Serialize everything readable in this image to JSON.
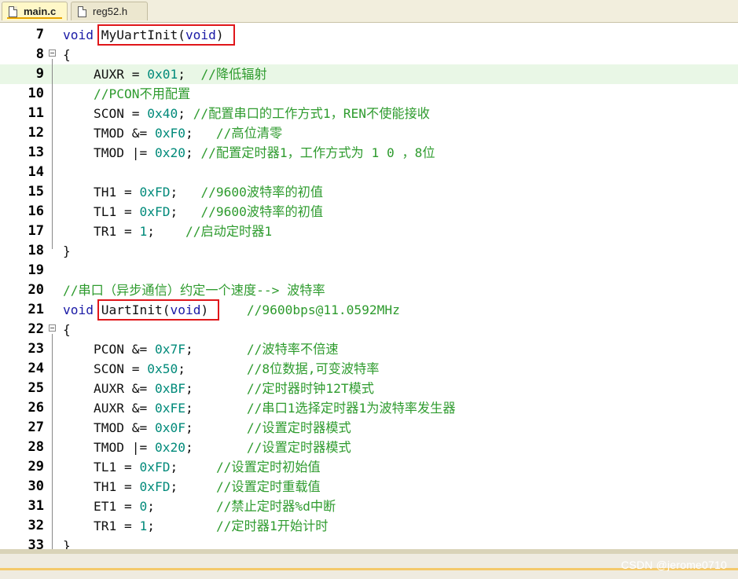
{
  "tabs": [
    {
      "label": "main.c",
      "active": true
    },
    {
      "label": "reg52.h",
      "active": false
    }
  ],
  "lines": [
    {
      "n": "7",
      "fold": false,
      "hl": false,
      "segs": [
        [
          "kw",
          "void"
        ],
        [
          "t",
          " "
        ],
        [
          "t",
          "MyUartInit("
        ],
        [
          "kw",
          "void"
        ],
        [
          "t",
          ")"
        ]
      ]
    },
    {
      "n": "8",
      "fold": true,
      "hl": false,
      "segs": [
        [
          "t",
          "{"
        ]
      ]
    },
    {
      "n": "9",
      "fold": false,
      "hl": true,
      "segs": [
        [
          "t",
          "    AUXR = "
        ],
        [
          "num",
          "0x01"
        ],
        [
          "t",
          ";  "
        ],
        [
          "cm",
          "//降低辐射"
        ]
      ]
    },
    {
      "n": "10",
      "fold": false,
      "hl": false,
      "segs": [
        [
          "cm",
          "    //PCON不用配置"
        ]
      ]
    },
    {
      "n": "11",
      "fold": false,
      "hl": false,
      "segs": [
        [
          "t",
          "    SCON = "
        ],
        [
          "num",
          "0x40"
        ],
        [
          "t",
          "; "
        ],
        [
          "cm",
          "//配置串口的工作方式1，REN不使能接收"
        ]
      ]
    },
    {
      "n": "12",
      "fold": false,
      "hl": false,
      "segs": [
        [
          "t",
          "    TMOD &= "
        ],
        [
          "num",
          "0xF0"
        ],
        [
          "t",
          ";   "
        ],
        [
          "cm",
          "//高位清零"
        ]
      ]
    },
    {
      "n": "13",
      "fold": false,
      "hl": false,
      "segs": [
        [
          "t",
          "    TMOD |= "
        ],
        [
          "num",
          "0x20"
        ],
        [
          "t",
          "; "
        ],
        [
          "cm",
          "//配置定时器1，工作方式为 1 0 ，8位"
        ]
      ]
    },
    {
      "n": "14",
      "fold": false,
      "hl": false,
      "segs": [
        [
          "t",
          ""
        ]
      ]
    },
    {
      "n": "15",
      "fold": false,
      "hl": false,
      "segs": [
        [
          "t",
          "    TH1 = "
        ],
        [
          "num",
          "0xFD"
        ],
        [
          "t",
          ";   "
        ],
        [
          "cm",
          "//9600波特率的初值"
        ]
      ]
    },
    {
      "n": "16",
      "fold": false,
      "hl": false,
      "segs": [
        [
          "t",
          "    TL1 = "
        ],
        [
          "num",
          "0xFD"
        ],
        [
          "t",
          ";   "
        ],
        [
          "cm",
          "//9600波特率的初值"
        ]
      ]
    },
    {
      "n": "17",
      "fold": false,
      "hl": false,
      "segs": [
        [
          "t",
          "    TR1 = "
        ],
        [
          "num",
          "1"
        ],
        [
          "t",
          ";    "
        ],
        [
          "cm",
          "//启动定时器1"
        ]
      ]
    },
    {
      "n": "18",
      "fold": false,
      "hl": false,
      "segs": [
        [
          "t",
          "}"
        ]
      ]
    },
    {
      "n": "19",
      "fold": false,
      "hl": false,
      "segs": [
        [
          "t",
          ""
        ]
      ]
    },
    {
      "n": "20",
      "fold": false,
      "hl": false,
      "segs": [
        [
          "cm",
          "//串口（异步通信）约定一个速度--> 波特率"
        ]
      ]
    },
    {
      "n": "21",
      "fold": false,
      "hl": false,
      "segs": [
        [
          "kw",
          "void"
        ],
        [
          "t",
          " "
        ],
        [
          "t",
          "UartInit("
        ],
        [
          "kw",
          "void"
        ],
        [
          "t",
          ")"
        ],
        [
          "t",
          "     "
        ],
        [
          "cm",
          "//9600bps@11.0592MHz"
        ]
      ]
    },
    {
      "n": "22",
      "fold": true,
      "hl": false,
      "segs": [
        [
          "t",
          "{"
        ]
      ]
    },
    {
      "n": "23",
      "fold": false,
      "hl": false,
      "segs": [
        [
          "t",
          "    PCON &= "
        ],
        [
          "num",
          "0x7F"
        ],
        [
          "t",
          ";       "
        ],
        [
          "cm",
          "//波特率不倍速"
        ]
      ]
    },
    {
      "n": "24",
      "fold": false,
      "hl": false,
      "segs": [
        [
          "t",
          "    SCON = "
        ],
        [
          "num",
          "0x50"
        ],
        [
          "t",
          ";        "
        ],
        [
          "cm",
          "//8位数据,可变波特率"
        ]
      ]
    },
    {
      "n": "25",
      "fold": false,
      "hl": false,
      "segs": [
        [
          "t",
          "    AUXR &= "
        ],
        [
          "num",
          "0xBF"
        ],
        [
          "t",
          ";       "
        ],
        [
          "cm",
          "//定时器时钟12T模式"
        ]
      ]
    },
    {
      "n": "26",
      "fold": false,
      "hl": false,
      "segs": [
        [
          "t",
          "    AUXR &= "
        ],
        [
          "num",
          "0xFE"
        ],
        [
          "t",
          ";       "
        ],
        [
          "cm",
          "//串口1选择定时器1为波特率发生器"
        ]
      ]
    },
    {
      "n": "27",
      "fold": false,
      "hl": false,
      "segs": [
        [
          "t",
          "    TMOD &= "
        ],
        [
          "num",
          "0x0F"
        ],
        [
          "t",
          ";       "
        ],
        [
          "cm",
          "//设置定时器模式"
        ]
      ]
    },
    {
      "n": "28",
      "fold": false,
      "hl": false,
      "segs": [
        [
          "t",
          "    TMOD |= "
        ],
        [
          "num",
          "0x20"
        ],
        [
          "t",
          ";       "
        ],
        [
          "cm",
          "//设置定时器模式"
        ]
      ]
    },
    {
      "n": "29",
      "fold": false,
      "hl": false,
      "segs": [
        [
          "t",
          "    TL1 = "
        ],
        [
          "num",
          "0xFD"
        ],
        [
          "t",
          ";     "
        ],
        [
          "cm",
          "//设置定时初始值"
        ]
      ]
    },
    {
      "n": "30",
      "fold": false,
      "hl": false,
      "segs": [
        [
          "t",
          "    TH1 = "
        ],
        [
          "num",
          "0xFD"
        ],
        [
          "t",
          ";     "
        ],
        [
          "cm",
          "//设置定时重载值"
        ]
      ]
    },
    {
      "n": "31",
      "fold": false,
      "hl": false,
      "segs": [
        [
          "t",
          "    ET1 = "
        ],
        [
          "num",
          "0"
        ],
        [
          "t",
          ";        "
        ],
        [
          "cm",
          "//禁止定时器%d中断"
        ]
      ]
    },
    {
      "n": "32",
      "fold": false,
      "hl": false,
      "segs": [
        [
          "t",
          "    TR1 = "
        ],
        [
          "num",
          "1"
        ],
        [
          "t",
          ";        "
        ],
        [
          "cm",
          "//定时器1开始计时"
        ]
      ]
    },
    {
      "n": "33",
      "fold": false,
      "hl": false,
      "segs": [
        [
          "t",
          "}"
        ]
      ]
    }
  ],
  "watermark": "CSDN @jerome0710",
  "colors": {
    "keyword": "#1a1aa6",
    "number": "#008a7a",
    "comment": "#2e9b2e",
    "highlight_line": "#e9f7e6",
    "annotation_box": "#e0161a"
  }
}
